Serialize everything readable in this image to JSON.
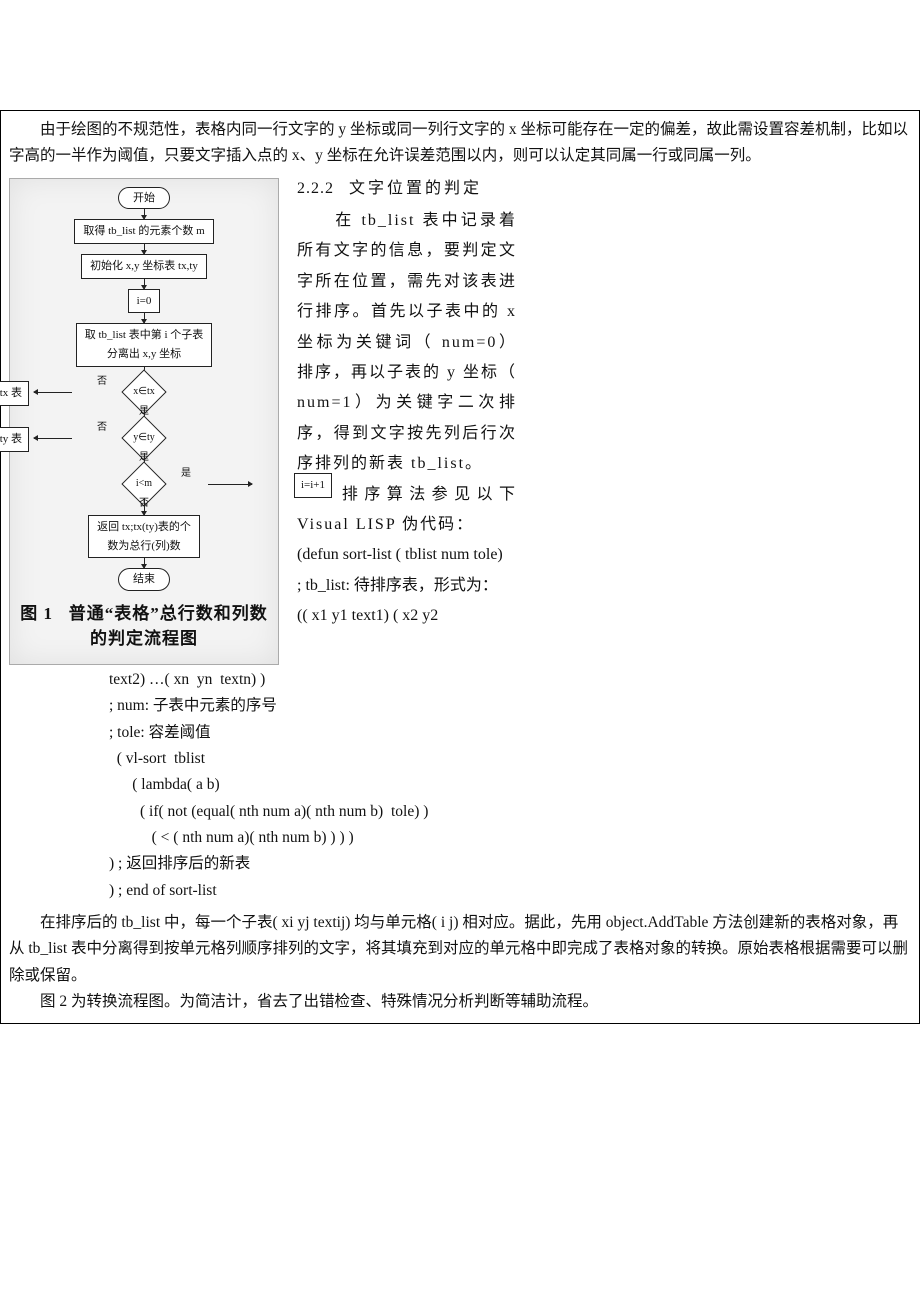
{
  "intro": {
    "p1": "由于绘图的不规范性，表格内同一行文字的 y 坐标或同一列行文字的 x 坐标可能存在一定的偏差，故此需设置容差机制，比如以字高的一半作为阈值，只要文字插入点的 x、y 坐标在允许误差范围以内，则可以认定其同属一行或同属一列。"
  },
  "flow": {
    "start": "开始",
    "s1": "取得 tb_list 的元素个数 m",
    "s2": "初始化 x,y 坐标表 tx,ty",
    "s3": "i=0",
    "s4": "取 tb_list 表中第 i 个子表\n分离出 x,y 坐标",
    "d1": "x∈tx",
    "d1_no": "否",
    "d1_yes": "是",
    "d1_side": "将 x 插入 tx 表",
    "d2": "y∈ty",
    "d2_no": "否",
    "d2_yes": "是",
    "d2_side": "将 y 插入 ty 表",
    "d3": "i<m",
    "d3_yes": "是",
    "d3_side": "i=i+1",
    "d3_no": "否",
    "s5": "返回 tx;tx(ty)表的个\n数为总行(列)数",
    "end": "结束"
  },
  "caption": {
    "fig_no": "图 1",
    "title1": "普通“表格”总行数和列数",
    "title2": "的判定流程图"
  },
  "right": {
    "heading_num": "2.2.2",
    "heading_txt": "文字位置的判定",
    "body": "　　在 tb_list 表中记录着所有文字的信息，要判定文字所在位置，需先对该表进行排序。首先以子表中的 x 坐标为关键词（ num=0）排序，再以子表的 y 坐标（ num=1）为关键字二次排序，得到文字按先列后行次序排列的新表 tb_list。",
    "body2": "　　排序算法参见以下 Visual LISP 伪代码：",
    "code1": "(defun sort-list ( tblist num tole)",
    "code2": "; tb_list: 待排序表，形式为：",
    "code3": "(( x1  y1  text1) ( x2  y2"
  },
  "code_cont": {
    "l0": "text2) …( xn  yn  textn) )",
    "l1": "; num: 子表中元素的序号",
    "l2": "; tole: 容差阈值",
    "l3": "  ( vl-sort  tblist",
    "l4": "      ( lambda( a b)",
    "l5": "        ( if( not (equal( nth num a)( nth num b)  tole) )",
    "l6": "           ( < ( nth num a)( nth num b) ) ) )",
    "l7": ") ; 返回排序后的新表",
    "l8": ") ; end of sort-list"
  },
  "tail": {
    "p1": "在排序后的 tb_list 中，每一个子表( xi yj textij)  均与单元格( i j)  相对应。据此，先用 object.AddTable  方法创建新的表格对象，再从 tb_list  表中分离得到按单元格列顺序排列的文字，将其填充到对应的单元格中即完成了表格对象的转换。原始表格根据需要可以删除或保留。",
    "p2": "图 2 为转换流程图。为简洁计，省去了出错检查、特殊情况分析判断等辅助流程。"
  }
}
